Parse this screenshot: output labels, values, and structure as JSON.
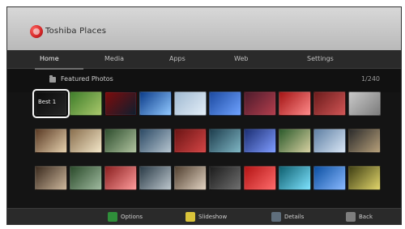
{
  "header": {
    "brand": "Toshiba Places"
  },
  "tabs": [
    {
      "label": "Home",
      "active": true
    },
    {
      "label": "Media",
      "active": false
    },
    {
      "label": "Apps",
      "active": false
    },
    {
      "label": "Web",
      "active": false
    },
    {
      "label": "Settings",
      "active": false
    }
  ],
  "section": {
    "title": "Featured Photos",
    "count": "1/240"
  },
  "grid": {
    "rows": 3,
    "cols": 10,
    "tiles": [
      {
        "selected": true,
        "label": "Best 1",
        "colors": [
          "#0b0b0b",
          "#262626"
        ]
      },
      {
        "colors": [
          "#3e7d2a",
          "#aac86c"
        ]
      },
      {
        "colors": [
          "#7d0b0b",
          "#0e1e2e"
        ]
      },
      {
        "colors": [
          "#0b3c8a",
          "#91c8ff"
        ]
      },
      {
        "colors": [
          "#a0b9d1",
          "#e3eef8"
        ]
      },
      {
        "colors": [
          "#1c4aa1",
          "#6fa2ff"
        ]
      },
      {
        "colors": [
          "#4d1b2b",
          "#b33e4d"
        ]
      },
      {
        "colors": [
          "#a31414",
          "#ff8a8a"
        ]
      },
      {
        "colors": [
          "#6b1b1b",
          "#d15555"
        ]
      },
      {
        "colors": [
          "#c9c9c9",
          "#7c7c7c"
        ]
      },
      {
        "colors": [
          "#5a3a24",
          "#e5d0ad"
        ]
      },
      {
        "colors": [
          "#8a6f4e",
          "#f2e6c8"
        ]
      },
      {
        "colors": [
          "#2d4d2d",
          "#b0c39f"
        ]
      },
      {
        "colors": [
          "#2c4a65",
          "#b5c4cf"
        ]
      },
      {
        "colors": [
          "#6b1414",
          "#d44545"
        ]
      },
      {
        "colors": [
          "#1d3d4d",
          "#7fb6c4"
        ]
      },
      {
        "colors": [
          "#1b2e73",
          "#7f9cff"
        ]
      },
      {
        "colors": [
          "#2b5a2b",
          "#d6d0a1"
        ]
      },
      {
        "colors": [
          "#5e7fa3",
          "#d9e6f5"
        ]
      },
      {
        "colors": [
          "#2b2b2b",
          "#b7a07a"
        ]
      },
      {
        "colors": [
          "#3a2a1e",
          "#cdb79c"
        ]
      },
      {
        "colors": [
          "#2a4a2a",
          "#9fba9f"
        ]
      },
      {
        "colors": [
          "#8a1f1f",
          "#ff9b9b"
        ]
      },
      {
        "colors": [
          "#2a3b47",
          "#bcc6cc"
        ]
      },
      {
        "colors": [
          "#514030",
          "#e2d3c2"
        ]
      },
      {
        "colors": [
          "#1b1b1b",
          "#6f6f6f"
        ]
      },
      {
        "colors": [
          "#b31414",
          "#ff6b6b"
        ]
      },
      {
        "colors": [
          "#0e5f6f",
          "#7ee3ff"
        ]
      },
      {
        "colors": [
          "#0b4fa1",
          "#89b9ff"
        ]
      },
      {
        "colors": [
          "#3f3f14",
          "#e2d66b"
        ]
      }
    ]
  },
  "footer": {
    "hints": [
      {
        "key_color": "#2f8e3a",
        "label": "Options"
      },
      {
        "key_color": "#d9c33a",
        "label": "Slideshow"
      },
      {
        "key_color": "#5f6e7c",
        "label": "Details"
      },
      {
        "key_color": "#7e7e7e",
        "label": "Back"
      }
    ]
  }
}
